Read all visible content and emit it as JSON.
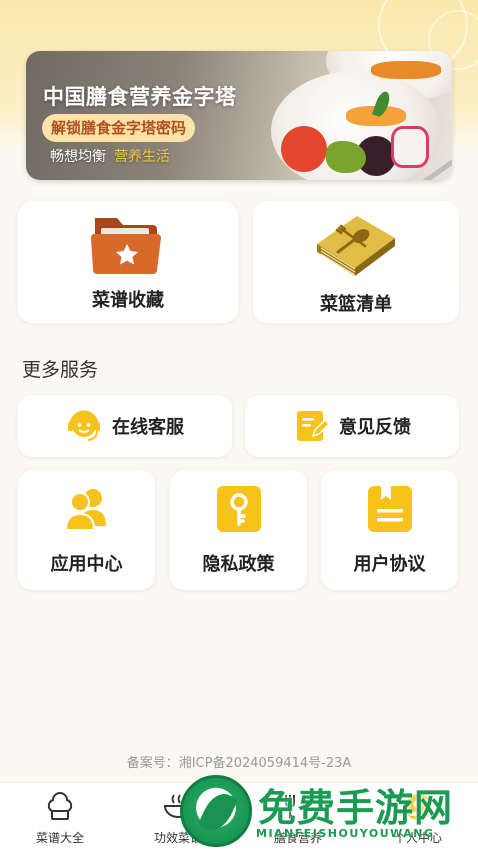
{
  "banner": {
    "title": "中国膳食营养金字塔",
    "tag": "解锁膳食金字塔密码",
    "subtitle_plain": "畅想均衡",
    "subtitle_highlight": "营养生活"
  },
  "cards": {
    "favorites_label": "菜谱收藏",
    "basket_label": "菜篮清单"
  },
  "more_services": {
    "title": "更多服务",
    "online_service_label": "在线客服",
    "feedback_label": "意见反馈",
    "app_center_label": "应用中心",
    "privacy_label": "隐私政策",
    "agreement_label": "用户协议"
  },
  "icp": "备案号：湘ICP备2024059414号-23A",
  "tabbar": {
    "tabs": [
      {
        "label": "菜谱大全",
        "icon": "chef-hat-icon"
      },
      {
        "label": "功效菜谱",
        "icon": "bowl-icon"
      },
      {
        "label": "膳食营养",
        "icon": "nutrition-icon"
      },
      {
        "label": "个人中心",
        "icon": "user-icon"
      }
    ]
  },
  "watermark": {
    "text": "免费手游网",
    "url": "MIANFEISHOUYOUWANG"
  },
  "colors": {
    "accent_yellow": "#f7c21c",
    "folder_orange": "#d8692a",
    "book_gold": "#c9a12c",
    "background": "#fbf9f1",
    "watermark_green": "#1a9a52"
  }
}
